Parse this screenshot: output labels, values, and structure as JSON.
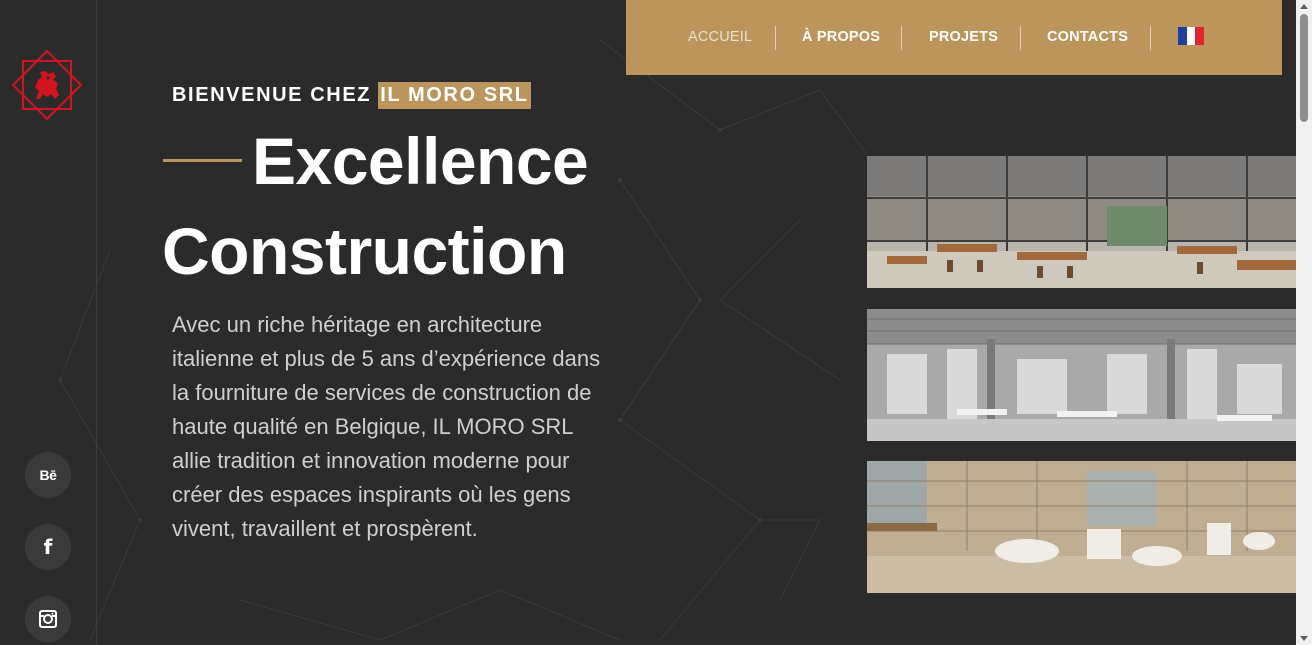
{
  "nav": {
    "items": [
      {
        "label": "ACCUEIL",
        "active": true
      },
      {
        "label": "À PROPOS",
        "active": false
      },
      {
        "label": "PROJETS",
        "active": false
      },
      {
        "label": "CONTACTS",
        "active": false
      }
    ],
    "language_flag": "french-flag-icon"
  },
  "hero": {
    "subtitle_prefix": "BIENVENUE CHEZ ",
    "subtitle_highlight": "IL MORO SRL",
    "headline_line1": "Excellence",
    "headline_line2": "Construction",
    "body": "Avec un riche héritage en architecture italienne et plus de 5 ans d’expérience dans la fourniture de services de construction de haute qualité en Belgique, IL MORO SRL allie tradition et innovation moderne pour créer des espaces inspirants où les gens vivent, travaillent et prospèrent."
  },
  "social": [
    {
      "icon": "behance-icon",
      "glyph": "Bē"
    },
    {
      "icon": "facebook-icon",
      "glyph": "f"
    },
    {
      "icon": "instagram-icon",
      "glyph": ""
    }
  ],
  "colors": {
    "accent": "#bb955b",
    "background": "#2b2b2c",
    "logo_red": "#d4141c"
  }
}
